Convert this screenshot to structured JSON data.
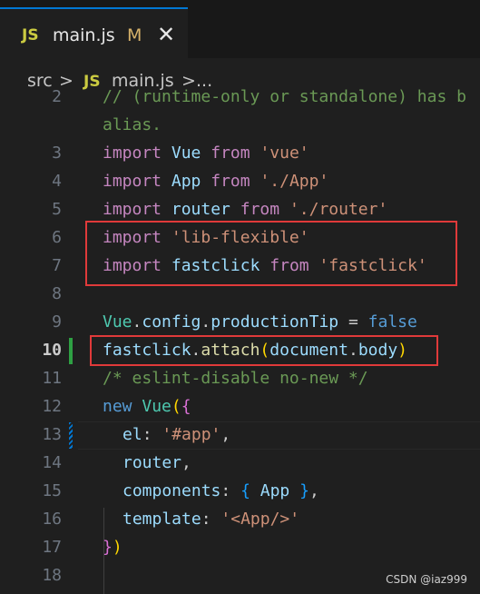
{
  "tab": {
    "icon": "JS",
    "filename": "main.js",
    "status": "M",
    "close": "✕"
  },
  "breadcrumb": {
    "folder": "src",
    "sep1": ">",
    "icon": "JS",
    "file": "main.js",
    "sep2": ">",
    "more": "..."
  },
  "lines": {
    "l2a": {
      "num": "2",
      "code": "// (runtime-only or standalone) has b"
    },
    "l2b": {
      "code": "alias."
    },
    "l3": {
      "num": "3",
      "kw": "import",
      "name": "Vue",
      "from": "from",
      "src": "'vue'"
    },
    "l4": {
      "num": "4",
      "kw": "import",
      "name": "App",
      "from": "from",
      "src": "'./App'"
    },
    "l5": {
      "num": "5",
      "kw": "import",
      "name": "router",
      "from": "from",
      "src": "'./router'"
    },
    "l6": {
      "num": "6",
      "kw": "import",
      "src": "'lib-flexible'"
    },
    "l7": {
      "num": "7",
      "kw": "import",
      "name": "fastclick",
      "from": "from",
      "src": "'fastclick'"
    },
    "l8": {
      "num": "8"
    },
    "l9": {
      "num": "9",
      "obj": "Vue",
      "dot1": ".",
      "prop1": "config",
      "dot2": ".",
      "prop2": "productionTip",
      "eq": " = ",
      "val": "false"
    },
    "l10": {
      "num": "10",
      "obj": "fastclick",
      "dot1": ".",
      "fn": "attach",
      "open": "(",
      "arg": "document",
      "dot2": ".",
      "prop": "body",
      "close": ")"
    },
    "l11": {
      "num": "11",
      "code": "/* eslint-disable no-new */"
    },
    "l12": {
      "num": "12",
      "kw": "new",
      "cls": "Vue",
      "open": "(",
      "brace": "{"
    },
    "l13": {
      "num": "13",
      "key": "el",
      "colon": ": ",
      "val": "'#app'",
      "comma": ","
    },
    "l14": {
      "num": "14",
      "key": "router",
      "comma": ","
    },
    "l15": {
      "num": "15",
      "key": "components",
      "colon": ": ",
      "open": "{ ",
      "val": "App",
      "close": " }",
      "comma": ","
    },
    "l16": {
      "num": "16",
      "key": "template",
      "colon": ": ",
      "val": "'<App/>'"
    },
    "l17": {
      "num": "17",
      "close1": "}",
      "close2": ")"
    },
    "l18": {
      "num": "18"
    }
  },
  "watermark": "CSDN @iaz999",
  "colors": {
    "accent": "#0078d4",
    "highlight_box": "#e03a3a",
    "added": "#2ea043",
    "background": "#1f1f1f"
  }
}
